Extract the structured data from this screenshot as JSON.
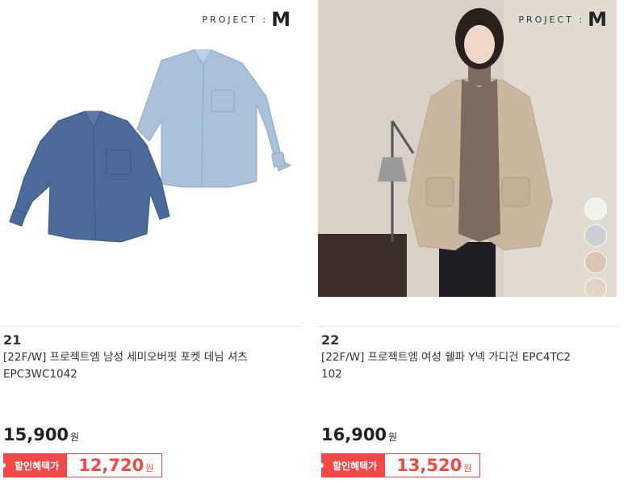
{
  "products": [
    {
      "rank": "21",
      "brand_text": "PROJECT :",
      "brand_mark": "M",
      "title_line1": "[22F/W] 프로젝트엠 남성 세미오버핏 포켓 데님 셔츠",
      "title_line2": "EPC3WC1042",
      "price": "15,900",
      "won": "원",
      "sale_label": "할인혜택가",
      "sale_price": "12,720",
      "sale_won": "원"
    },
    {
      "rank": "22",
      "brand_text": "PROJECT :",
      "brand_mark": "M",
      "title_line1": "[22F/W] 프로젝트엠 여성 쉘파 Y넥 가디건 EPC4TC2",
      "title_line2": "102",
      "price": "16,900",
      "won": "원",
      "sale_label": "할인혜택가",
      "sale_price": "13,520",
      "sale_won": "원",
      "swatch_colors": [
        "#f3f1ee",
        "#c9cfd4",
        "#dcc6b3",
        "#e4d4c8"
      ]
    }
  ]
}
